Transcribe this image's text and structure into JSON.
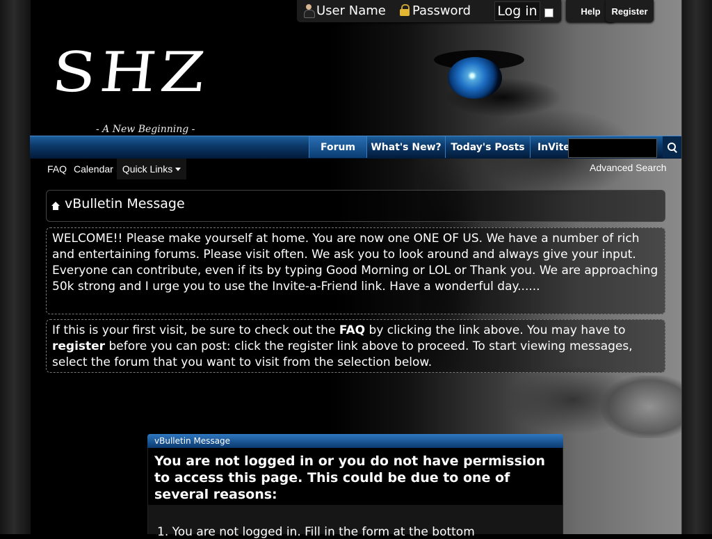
{
  "login": {
    "username_placeholder": "User Name",
    "password_placeholder": "Password",
    "login_label": "Log in"
  },
  "top_buttons": {
    "help": "Help",
    "register": "Register"
  },
  "logo": {
    "text": "SHZ",
    "tagline": "- A New Beginning -"
  },
  "nav": {
    "tabs": [
      "Forum",
      "What's New?",
      "Today's Posts",
      "InVite-"
    ],
    "search_placeholder": ""
  },
  "subnav": {
    "faq": "FAQ",
    "calendar": "Calendar",
    "quick_links": "Quick Links",
    "advanced_search": "Advanced Search"
  },
  "breadcrumb": {
    "title": "vBulletin Message"
  },
  "welcome": {
    "text": "WELCOME!! Please make yourself at home. You are now one ONE OF US. We have a number of rich and entertaining forums. Please visit often. We ask you to look around and always give your input. Everyone can contribute, even if its by typing Good Morning or LOL or Thank you. We are approaching 50k strong and I urge you to use the Invite-a-Friend link. Have a wonderful day......"
  },
  "first_visit": {
    "part1": "If this is your first visit, be sure to check out the ",
    "faq": "FAQ",
    "part2": " by clicking the link above. You may have to ",
    "register": "register",
    "part3": " before you can post: click the register link above to proceed. To start viewing messages, select the forum that you want to visit from the selection below."
  },
  "message": {
    "header": "vBulletin Message",
    "title": "You are not logged in or you do not have permission to access this page. This could be due to one of several reasons:",
    "item_1": "1.  You are not logged in. Fill in the form at the bottom"
  },
  "colors": {
    "nav_blue": "#0d3a6b",
    "accent_eye": "#1e6fc4",
    "background": "#000000"
  }
}
